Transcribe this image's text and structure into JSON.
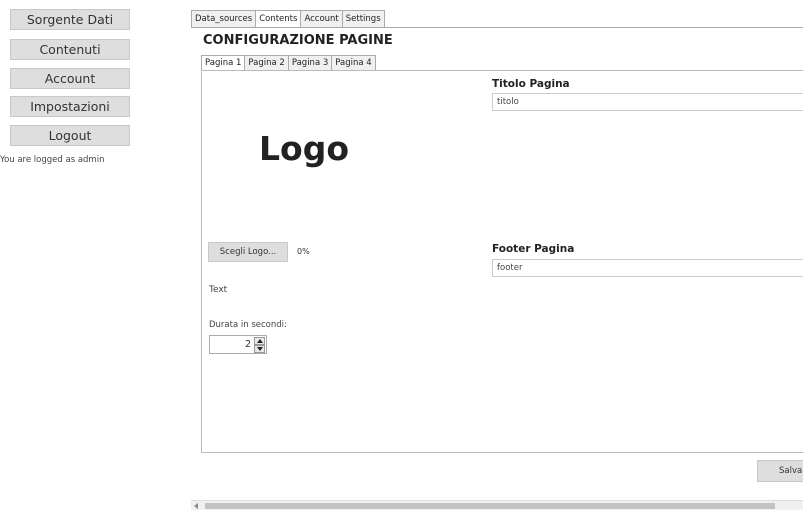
{
  "sidebar": {
    "items": [
      {
        "label": "Sorgente Dati"
      },
      {
        "label": "Contenuti"
      },
      {
        "label": "Account"
      },
      {
        "label": "Impostazioni"
      },
      {
        "label": "Logout"
      }
    ],
    "login_status": "You are logged as admin"
  },
  "top_tabs": [
    {
      "label": "Data_sources"
    },
    {
      "label": "Contents"
    },
    {
      "label": "Account"
    },
    {
      "label": "Settings"
    }
  ],
  "active_top_tab": "Contents",
  "page_title": "CONFIGURAZIONE PAGINE",
  "sub_tabs": [
    {
      "label": "Pagina 1"
    },
    {
      "label": "Pagina 2"
    },
    {
      "label": "Pagina 3"
    },
    {
      "label": "Pagina 4"
    }
  ],
  "active_sub_tab": "Pagina 1",
  "page": {
    "logo_text": "Logo",
    "choose_logo_label": "Scegli Logo...",
    "upload_progress": "0%",
    "text_label": "Text",
    "duration_label": "Durata in secondi:",
    "duration_value": "2",
    "title_label": "Titolo Pagina",
    "title_value": "titolo",
    "footer_label": "Footer Pagina",
    "footer_value": "footer"
  },
  "save_label": "Salva"
}
